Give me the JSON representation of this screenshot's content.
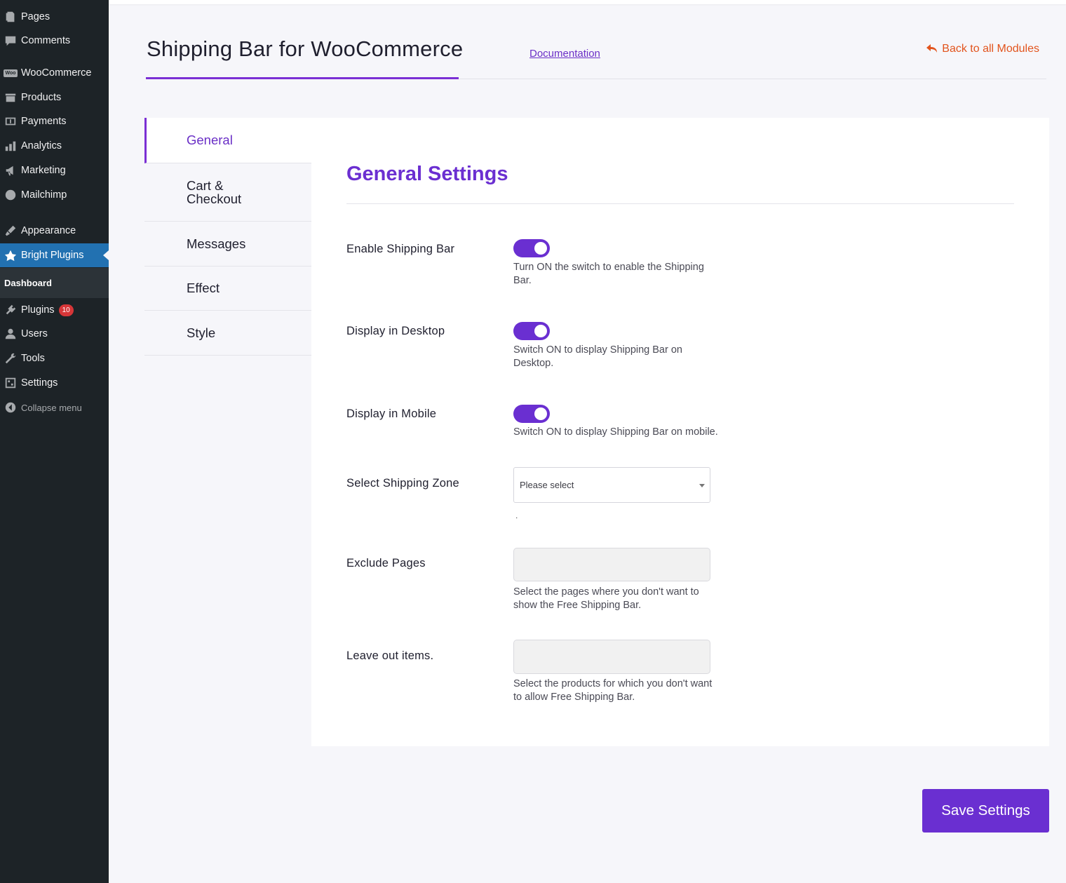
{
  "sidebar": {
    "items": [
      {
        "label": "Pages",
        "icon": "pages-icon"
      },
      {
        "label": "Comments",
        "icon": "comments-icon"
      },
      {
        "label": "WooCommerce",
        "icon": "woocommerce-icon"
      },
      {
        "label": "Products",
        "icon": "products-icon"
      },
      {
        "label": "Payments",
        "icon": "payments-icon"
      },
      {
        "label": "Analytics",
        "icon": "analytics-icon"
      },
      {
        "label": "Marketing",
        "icon": "marketing-icon"
      },
      {
        "label": "Mailchimp",
        "icon": "mailchimp-icon"
      },
      {
        "label": "Appearance",
        "icon": "appearance-icon"
      },
      {
        "label": "Bright Plugins",
        "icon": "bright-plugins-icon"
      },
      {
        "label": "Plugins",
        "icon": "plugins-icon",
        "badge": "10"
      },
      {
        "label": "Users",
        "icon": "users-icon"
      },
      {
        "label": "Tools",
        "icon": "tools-icon"
      },
      {
        "label": "Settings",
        "icon": "settings-icon"
      },
      {
        "label": "Collapse menu",
        "icon": "collapse-icon"
      }
    ],
    "submenu_label": "Dashboard",
    "woo_icon_text": "Woo"
  },
  "header": {
    "title": "Shipping Bar for WooCommerce",
    "documentation_label": "Documentation",
    "back_label": "Back to all Modules"
  },
  "tabs": [
    {
      "label": "General"
    },
    {
      "label": "Cart &\nCheckout"
    },
    {
      "label": "Messages"
    },
    {
      "label": "Effect"
    },
    {
      "label": "Style"
    }
  ],
  "panel": {
    "title": "General Settings",
    "fields": {
      "enable_bar": {
        "label": "Enable Shipping Bar",
        "help": "Turn ON the switch to enable the Shipping Bar.",
        "on": true
      },
      "desktop": {
        "label": "Display in Desktop",
        "help": "Switch ON to display Shipping Bar on Desktop.",
        "on": true
      },
      "mobile": {
        "label": "Display in Mobile",
        "help": "Switch ON to display Shipping Bar on mobile.",
        "on": true
      },
      "zone": {
        "label": "Select Shipping Zone",
        "placeholder": "Please select",
        "dot": "."
      },
      "exclude_pages": {
        "label": "Exclude Pages",
        "help": "Select the pages where you don't want to show the Free Shipping Bar."
      },
      "leave_out": {
        "label": "Leave out items.",
        "help": "Select the products for which you don't want to allow Free Shipping Bar."
      }
    }
  },
  "save_label": "Save Settings",
  "colors": {
    "accent": "#6a2fd1",
    "back_link": "#e2541d",
    "sidebar_bg": "#1d2327",
    "sidebar_current": "#2271b1",
    "badge": "#d63638"
  }
}
